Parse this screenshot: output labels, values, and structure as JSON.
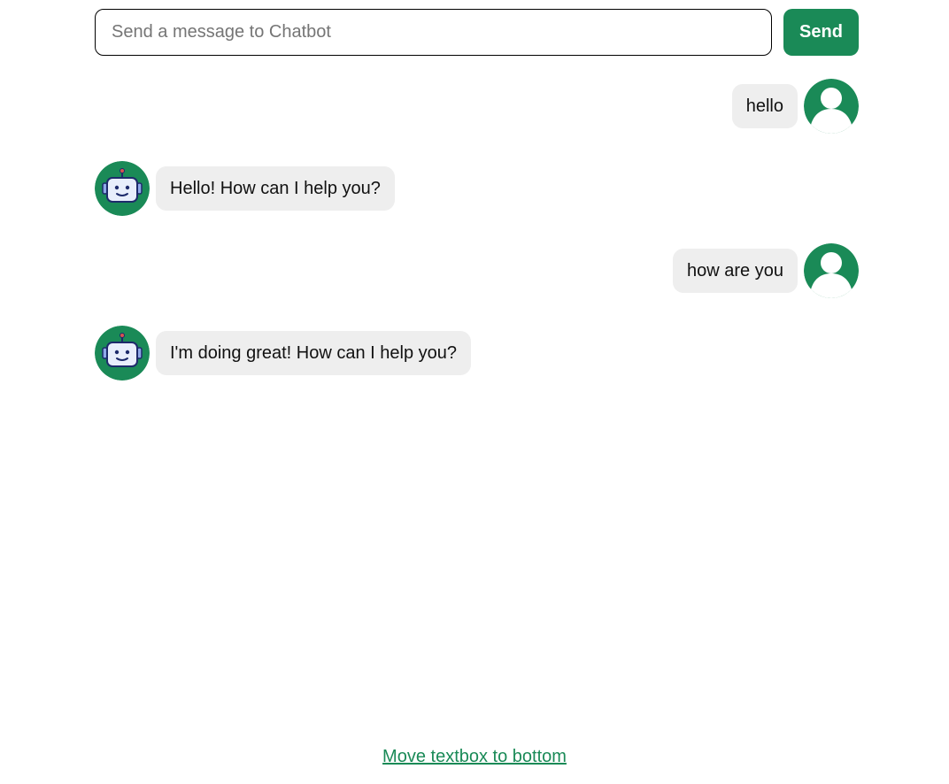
{
  "composer": {
    "placeholder": "Send a message to Chatbot",
    "value": "",
    "send_label": "Send"
  },
  "messages": [
    {
      "sender": "user",
      "text": "hello"
    },
    {
      "sender": "bot",
      "text": "Hello! How can I help you?"
    },
    {
      "sender": "user",
      "text": "how are you"
    },
    {
      "sender": "bot",
      "text": "I'm doing great! How can I help you?"
    }
  ],
  "footer": {
    "move_link": "Move textbox to bottom"
  },
  "colors": {
    "accent": "#1a8a57",
    "bubble": "#eeeeee",
    "robot_face": "#e8eefc",
    "robot_outline": "#1d2a6b"
  },
  "icons": {
    "user": "user-avatar-icon",
    "bot": "robot-avatar-icon"
  }
}
